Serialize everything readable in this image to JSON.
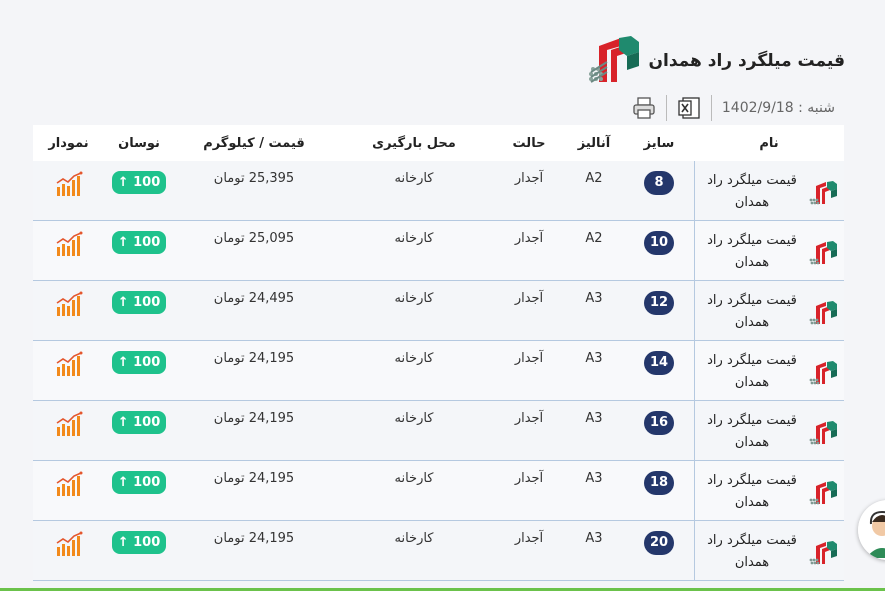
{
  "page": {
    "title": "قیمت میلگرد راد همدان"
  },
  "toolbar": {
    "date": "شنبه : 1402/9/18",
    "excel_icon": "excel-icon",
    "print_icon": "printer-icon"
  },
  "table": {
    "headers": {
      "name": "نام",
      "size": "سایز",
      "analyze": "آنالیز",
      "state": "حالت",
      "place": "محل بارگیری",
      "price": "قیمت / کیلوگرم",
      "change": "نوسان",
      "chart": "نمودار"
    },
    "rows": [
      {
        "name": "قیمت میلگرد راد همدان",
        "size": "8",
        "analyze": "A2",
        "state": "آجدار",
        "place": "کارخانه",
        "price": "25,395 تومان",
        "change": "100 ↑"
      },
      {
        "name": "قیمت میلگرد راد همدان",
        "size": "10",
        "analyze": "A2",
        "state": "آجدار",
        "place": "کارخانه",
        "price": "25,095 تومان",
        "change": "100 ↑"
      },
      {
        "name": "قیمت میلگرد راد همدان",
        "size": "12",
        "analyze": "A3",
        "state": "آجدار",
        "place": "کارخانه",
        "price": "24,495 تومان",
        "change": "100 ↑"
      },
      {
        "name": "قیمت میلگرد راد همدان",
        "size": "14",
        "analyze": "A3",
        "state": "آجدار",
        "place": "کارخانه",
        "price": "24,195 تومان",
        "change": "100 ↑"
      },
      {
        "name": "قیمت میلگرد راد همدان",
        "size": "16",
        "analyze": "A3",
        "state": "آجدار",
        "place": "کارخانه",
        "price": "24,195 تومان",
        "change": "100 ↑"
      },
      {
        "name": "قیمت میلگرد راد همدان",
        "size": "18",
        "analyze": "A3",
        "state": "آجدار",
        "place": "کارخانه",
        "price": "24,195 تومان",
        "change": "100 ↑"
      },
      {
        "name": "قیمت میلگرد راد همدان",
        "size": "20",
        "analyze": "A3",
        "state": "آجدار",
        "place": "کارخانه",
        "price": "24,195 تومان",
        "change": "100 ↑"
      }
    ]
  },
  "colors": {
    "size_badge": "#24376b",
    "change_badge": "#1ec28c",
    "chart_icon": "#f28a1b",
    "brand_red": "#d8232a",
    "brand_green": "#1f8a6e"
  }
}
